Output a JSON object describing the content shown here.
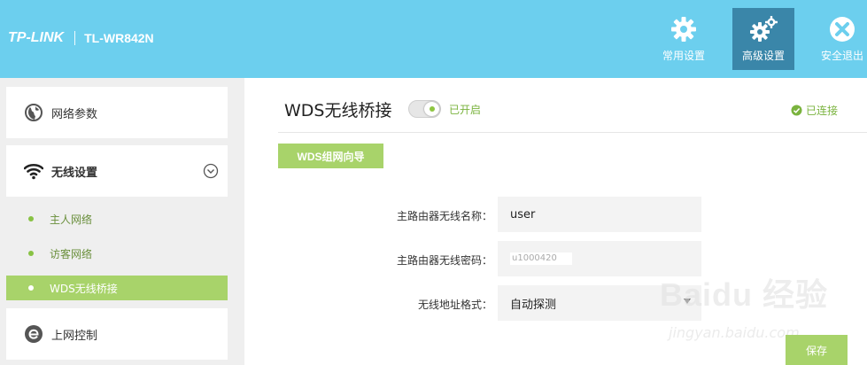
{
  "header": {
    "brand": "TP-LINK",
    "model": "TL-WR842N",
    "nav": [
      {
        "label": "常用设置",
        "icon": "gear-icon",
        "active": false
      },
      {
        "label": "高级设置",
        "icon": "gears-icon",
        "active": true
      },
      {
        "label": "安全退出",
        "icon": "close-icon",
        "active": false
      }
    ]
  },
  "sidebar": {
    "network": {
      "label": "网络参数",
      "icon": "globe-icon"
    },
    "wireless": {
      "label": "无线设置",
      "icon": "wifi-icon",
      "expanded": true
    },
    "subitems": [
      {
        "label": "主人网络",
        "active": false
      },
      {
        "label": "访客网络",
        "active": false
      },
      {
        "label": "WDS无线桥接",
        "active": true
      }
    ],
    "internet_control": {
      "label": "上网控制",
      "icon": "ie-icon"
    }
  },
  "main": {
    "title": "WDS无线桥接",
    "toggle_label": "已开启",
    "status": "已连接",
    "wizard_button": "WDS组网向导",
    "form": {
      "ssid_label": "主路由器无线名称：",
      "ssid_value": "user",
      "password_label": "主路由器无线密码：",
      "password_value": "u1000420",
      "address_label": "无线地址格式：",
      "address_value": "自动探测"
    },
    "save_button": "保存"
  },
  "watermark": {
    "logo": "Baidu 经验",
    "url": "jingyan.baidu.com"
  },
  "colors": {
    "header": "#6ccfee",
    "nav_active": "#3a86a9",
    "accent_green": "#a8d36a",
    "text_green": "#7ab33e"
  }
}
